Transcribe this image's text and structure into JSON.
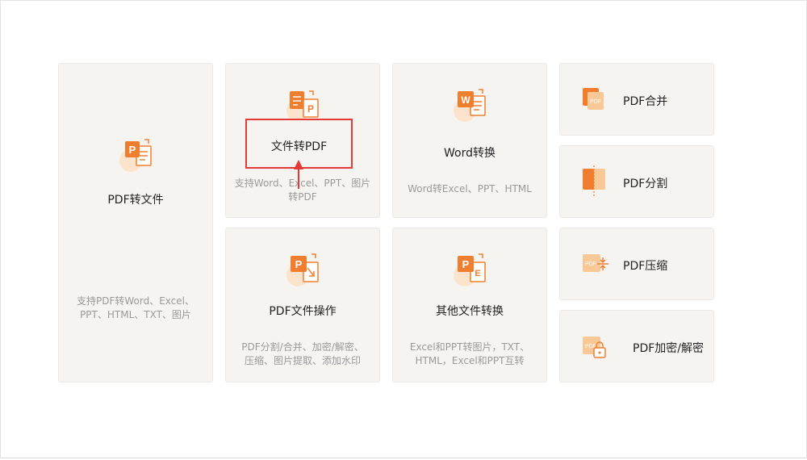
{
  "cards": {
    "pdf_to_file": {
      "title": "PDF转文件",
      "desc": [
        "支持PDF转Word、Excel、",
        "PPT、HTML、TXT、图片"
      ]
    },
    "file_to_pdf": {
      "title": "文件转PDF",
      "desc": [
        "支持Word、Excel、PPT、图片",
        "转PDF"
      ]
    },
    "word_convert": {
      "title": "Word转换",
      "desc": [
        "Word转Excel、PPT、HTML"
      ]
    },
    "pdf_ops": {
      "title": "PDF文件操作",
      "desc": [
        "PDF分割/合并、加密/解密、",
        "压缩、图片提取、添加水印"
      ]
    },
    "other_convert": {
      "title": "其他文件转换",
      "desc": [
        "Excel和PPT转图片，TXT、",
        "HTML，Excel和PPT互转"
      ]
    },
    "pdf_merge": {
      "title": "PDF合并"
    },
    "pdf_split": {
      "title": "PDF分割"
    },
    "pdf_compress": {
      "title": "PDF压缩"
    },
    "pdf_encrypt": {
      "title": "PDF加密/解密"
    }
  },
  "icons": {
    "pdf_badge_letter": "P",
    "word_badge_letter": "W",
    "pdf_label": "PDF"
  },
  "colors": {
    "accent": "#f07e2f",
    "accent_light": "#f8c997",
    "card_bg": "#f6f4f1",
    "highlight": "#e53935"
  }
}
